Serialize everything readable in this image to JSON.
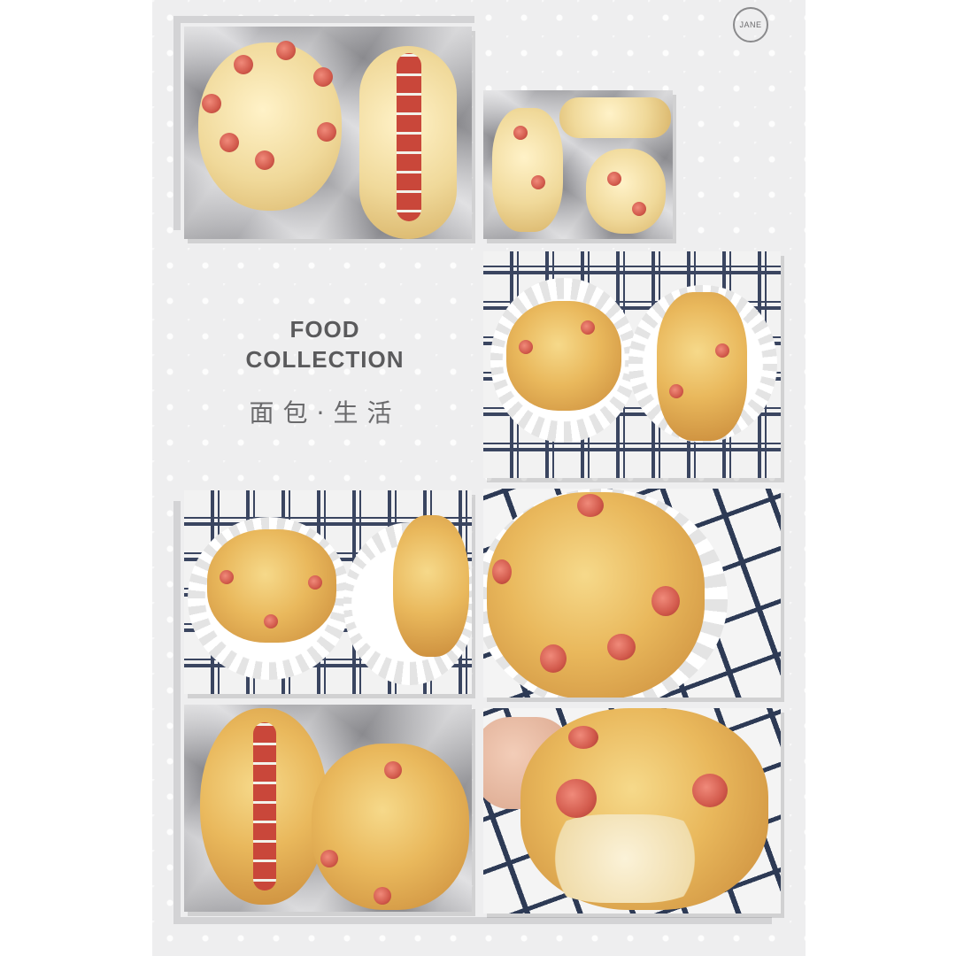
{
  "brand": {
    "badge_text": "JANE"
  },
  "title": {
    "line1": "FOOD",
    "line2": "COLLECTION",
    "subtitle": "面包·生活"
  },
  "colors": {
    "background": "#eeeeef",
    "title_text": "#5a5a5c",
    "frame": "#d3d3d5"
  },
  "photos": [
    {
      "name": "unbaked-flower-bun-and-hotdog-roll",
      "surface": "foil"
    },
    {
      "name": "unbaked-buns-tray",
      "surface": "foil"
    },
    {
      "name": "baked-flower-and-braid-buns",
      "surface": "checked-cloth"
    },
    {
      "name": "baked-flower-bun-and-plain-roll",
      "surface": "checked-cloth"
    },
    {
      "name": "baked-flower-bun-closeup",
      "surface": "checked-cloth"
    },
    {
      "name": "baked-hotdog-and-flower-buns",
      "surface": "foil"
    },
    {
      "name": "bitten-sausage-bun",
      "surface": "checked-cloth"
    }
  ]
}
